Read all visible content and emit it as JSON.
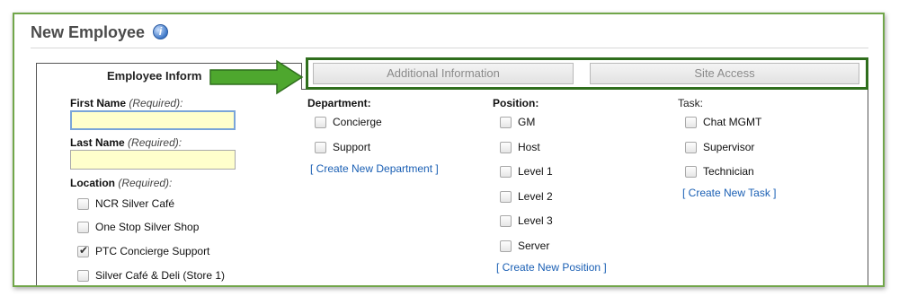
{
  "header": {
    "title": "New Employee",
    "info_icon": "info-icon"
  },
  "tabs": {
    "employee_info": "Employee Inform",
    "additional_info": "Additional Information",
    "site_access": "Site Access"
  },
  "colors": {
    "highlight_border": "#2f6e1d",
    "arrow": "#4ea72e",
    "required_input_bg": "#ffffcc",
    "link": "#1a5fb4"
  },
  "employee_form": {
    "first_name": {
      "label": "First Name",
      "required": "(Required):",
      "value": ""
    },
    "last_name": {
      "label": "Last Name",
      "required": "(Required):",
      "value": ""
    },
    "location": {
      "label": "Location",
      "required": "(Required):",
      "options": [
        {
          "label": "NCR Silver Café",
          "checked": false
        },
        {
          "label": "One Stop Silver Shop",
          "checked": false
        },
        {
          "label": "PTC Concierge Support",
          "checked": true
        },
        {
          "label": "Silver Café & Deli (Store 1)",
          "checked": false
        }
      ]
    }
  },
  "department": {
    "label": "Department:",
    "options": [
      {
        "label": "Concierge",
        "checked": false
      },
      {
        "label": "Support",
        "checked": false
      }
    ],
    "create_link": "[ Create New Department ]"
  },
  "position": {
    "label": "Position:",
    "options": [
      {
        "label": "GM",
        "checked": false
      },
      {
        "label": "Host",
        "checked": false
      },
      {
        "label": "Level 1",
        "checked": false
      },
      {
        "label": "Level 2",
        "checked": false
      },
      {
        "label": "Level 3",
        "checked": false
      },
      {
        "label": "Server",
        "checked": false
      }
    ],
    "create_link": "[ Create New Position ]"
  },
  "task": {
    "label": "Task:",
    "options": [
      {
        "label": "Chat MGMT",
        "checked": false
      },
      {
        "label": "Supervisor",
        "checked": false
      },
      {
        "label": "Technician",
        "checked": false
      }
    ],
    "create_link": "[ Create New Task ]"
  }
}
